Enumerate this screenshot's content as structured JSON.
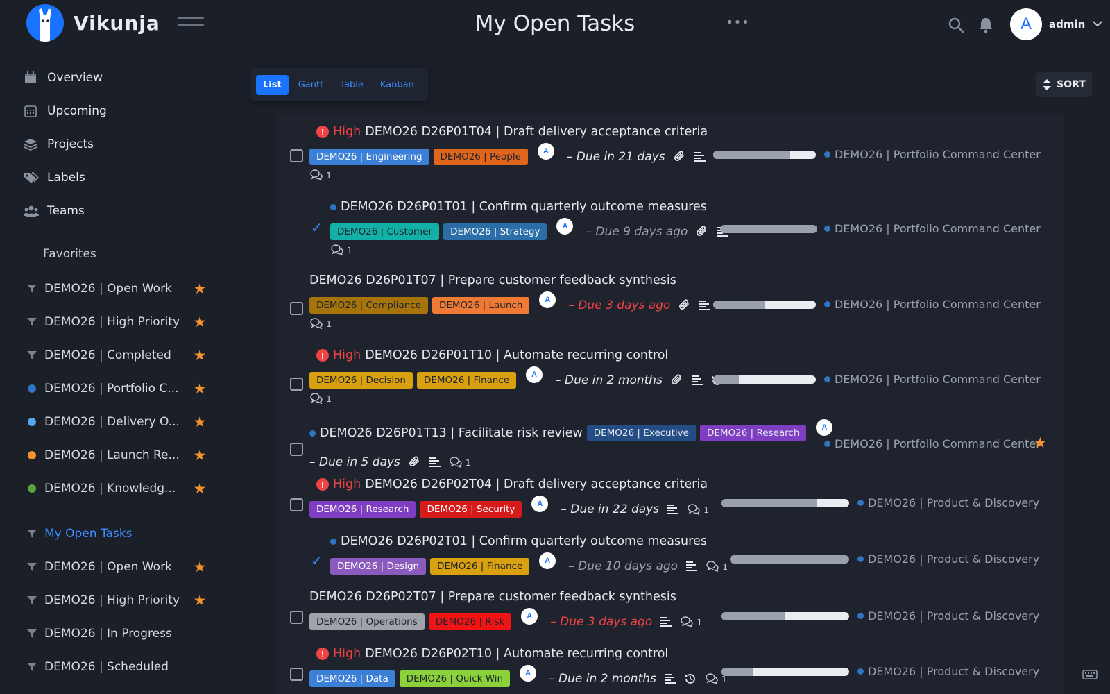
{
  "app": {
    "name": "Vikunja"
  },
  "header": {
    "title": "My Open Tasks",
    "more": "•••",
    "user": {
      "initial": "A",
      "name": "admin"
    }
  },
  "nav": [
    {
      "label": "Overview",
      "icon": "calendar-icon"
    },
    {
      "label": "Upcoming",
      "icon": "calendar-grid-icon"
    },
    {
      "label": "Projects",
      "icon": "layers-icon"
    },
    {
      "label": "Labels",
      "icon": "tags-icon"
    },
    {
      "label": "Teams",
      "icon": "users-icon"
    }
  ],
  "favorites": {
    "heading": "Favorites",
    "items": [
      {
        "label": "DEMO26 | Open Work",
        "kind": "filter",
        "starred": true
      },
      {
        "label": "DEMO26 | High Priority",
        "kind": "filter",
        "starred": true
      },
      {
        "label": "DEMO26 | Completed",
        "kind": "filter",
        "starred": true
      },
      {
        "label": "DEMO26 | Portfolio C...",
        "kind": "project",
        "color": "#3074c4",
        "starred": true
      },
      {
        "label": "DEMO26 | Delivery O...",
        "kind": "project",
        "color": "#5aa4ea",
        "starred": true
      },
      {
        "label": "DEMO26 | Launch Re...",
        "kind": "project",
        "color": "#f6922c",
        "starred": true
      },
      {
        "label": "DEMO26 | Knowledg...",
        "kind": "project",
        "color": "#5aa43a",
        "starred": true
      }
    ]
  },
  "filters": [
    {
      "label": "My Open Tasks",
      "active": true,
      "starred": false
    },
    {
      "label": "DEMO26 | Open Work",
      "starred": true
    },
    {
      "label": "DEMO26 | High Priority",
      "starred": true
    },
    {
      "label": "DEMO26 | In Progress",
      "starred": false
    },
    {
      "label": "DEMO26 | Scheduled",
      "starred": false
    }
  ],
  "views": {
    "list": "List",
    "gantt": "Gantt",
    "table": "Table",
    "kanban": "Kanban",
    "active": "List"
  },
  "sort": {
    "label": "SORT"
  },
  "tasks": [
    {
      "priority": "High",
      "title": "DEMO26 D26P01T04 | Draft delivery acceptance criteria",
      "labels": [
        {
          "text": "DEMO26 | Engineering",
          "bg": "#3c7fd6",
          "fg": "#ffffff"
        },
        {
          "text": "DEMO26 | People",
          "bg": "#e0661c",
          "fg": "#1e232d"
        }
      ],
      "assignee": "A",
      "due": "– Due in 21 days",
      "due_style": "normal",
      "comments": "1",
      "progress": 0.75,
      "project": "DEMO26 | Portfolio Command Center"
    },
    {
      "priority": "",
      "done": true,
      "title": "DEMO26 D26P01T01 | Confirm quarterly outcome measures",
      "labels": [
        {
          "text": "DEMO26 | Customer",
          "bg": "#13b0a8",
          "fg": "#1e232d"
        },
        {
          "text": "DEMO26 | Strategy",
          "bg": "#2b6ea7",
          "fg": "#ffffff"
        }
      ],
      "assignee": "A",
      "due": "– Due 9 days ago",
      "due_style": "muted",
      "comments": "1",
      "progress": 1.0,
      "project": "DEMO26 | Portfolio Command Center"
    },
    {
      "priority": "",
      "title": "DEMO26 D26P01T07 | Prepare customer feedback synthesis",
      "labels": [
        {
          "text": "DEMO26 | Compliance",
          "bg": "#a7740a",
          "fg": "#1e232d"
        },
        {
          "text": "DEMO26 | Launch",
          "bg": "#f07a34",
          "fg": "#1e232d"
        }
      ],
      "assignee": "A",
      "due": "– Due 3 days ago",
      "due_style": "overdue",
      "comments": "1",
      "progress": 0.5,
      "project": "DEMO26 | Portfolio Command Center"
    },
    {
      "priority": "High",
      "title": "DEMO26 D26P01T10 | Automate recurring control",
      "labels": [
        {
          "text": "DEMO26 | Decision",
          "bg": "#d9a10f",
          "fg": "#1e232d"
        },
        {
          "text": "DEMO26 | Finance",
          "bg": "#d9a10f",
          "fg": "#1e232d"
        }
      ],
      "assignee": "A",
      "due": "– Due in 2 months",
      "due_style": "normal",
      "comments": "1",
      "progress": 0.25,
      "project": "DEMO26 | Portfolio Command Center"
    },
    {
      "priority": "",
      "title": "DEMO26 D26P01T13 | Facilitate risk review",
      "labels": [
        {
          "text": "DEMO26 | Executive",
          "bg": "#244d86",
          "fg": "#e5e8ee"
        },
        {
          "text": "DEMO26 | Research",
          "bg": "#7f3ec2",
          "fg": "#e5e8ee"
        }
      ],
      "assignee": "A",
      "due": "– Due in 5 days",
      "due_style": "normal",
      "comments": "1",
      "progress": null,
      "project": "DEMO26 | Portfolio Command Center",
      "starred": true
    },
    {
      "priority": "High",
      "title": "DEMO26 D26P02T04 | Draft delivery acceptance criteria",
      "labels": [
        {
          "text": "DEMO26 | Research",
          "bg": "#7f3ec2",
          "fg": "#ffffff"
        },
        {
          "text": "DEMO26 | Security",
          "bg": "#d71a1a",
          "fg": "#ffffff"
        }
      ],
      "assignee": "A",
      "due": "– Due in 22 days",
      "due_style": "normal",
      "comments": "1",
      "progress": 0.75,
      "project": "DEMO26 | Product & Discovery"
    },
    {
      "priority": "",
      "done": true,
      "title": "DEMO26 D26P02T01 | Confirm quarterly outcome measures",
      "labels": [
        {
          "text": "DEMO26 | Design",
          "bg": "#8a5bbd",
          "fg": "#ffffff"
        },
        {
          "text": "DEMO26 | Finance",
          "bg": "#d9a10f",
          "fg": "#1e232d"
        }
      ],
      "assignee": "A",
      "due": "– Due 10 days ago",
      "due_style": "muted",
      "comments": "1",
      "progress": 1.0,
      "project": "DEMO26 | Product & Discovery"
    },
    {
      "priority": "",
      "title": "DEMO26 D26P02T07 | Prepare customer feedback synthesis",
      "labels": [
        {
          "text": "DEMO26 | Operations",
          "bg": "#a0a4aa",
          "fg": "#1e232d"
        },
        {
          "text": "DEMO26 | Risk",
          "bg": "#f01414",
          "fg": "#1e232d"
        }
      ],
      "assignee": "A",
      "due": "– Due 3 days ago",
      "due_style": "overdue",
      "comments": "1",
      "progress": 0.5,
      "project": "DEMO26 | Product & Discovery"
    },
    {
      "priority": "High",
      "title": "DEMO26 D26P02T10 | Automate recurring control",
      "labels": [
        {
          "text": "DEMO26 | Data",
          "bg": "#3c7fd6",
          "fg": "#ffffff"
        },
        {
          "text": "DEMO26 | Quick Win",
          "bg": "#8bd23a",
          "fg": "#1e232d"
        }
      ],
      "assignee": "A",
      "due": "– Due in 2 months",
      "due_style": "normal",
      "comments": "1",
      "progress": 0.25,
      "project": "DEMO26 | Product & Discovery"
    }
  ]
}
